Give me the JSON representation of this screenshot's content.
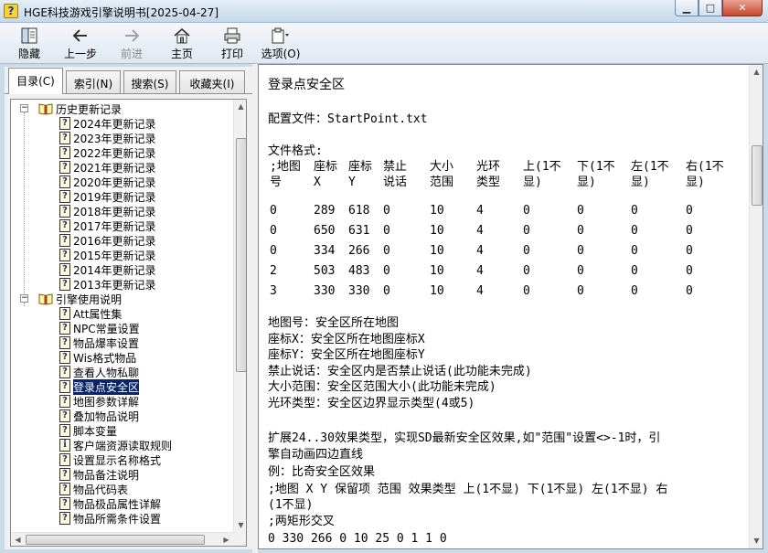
{
  "window": {
    "title": "HGE科技游戏引擎说明书[2025-04-27]",
    "app_icon": "?",
    "controls": {
      "minimize": "▁",
      "maximize": "□",
      "close": "✕"
    }
  },
  "toolbar": {
    "hide": "隐藏",
    "back": "上一步",
    "forward": "前进",
    "home": "主页",
    "print": "打印",
    "options": "选项(O)"
  },
  "tabs": [
    "目录(C)",
    "索引(N)",
    "搜索(S)",
    "收藏夹(I)"
  ],
  "tree": {
    "groups": [
      {
        "label": "历史更新记录",
        "expander": "−",
        "items": [
          {
            "label": "2024年更新记录",
            "icon": "question-doc-icon"
          },
          {
            "label": "2023年更新记录",
            "icon": "question-doc-icon"
          },
          {
            "label": "2022年更新记录",
            "icon": "question-doc-icon"
          },
          {
            "label": "2021年更新记录",
            "icon": "question-doc-icon"
          },
          {
            "label": "2020年更新记录",
            "icon": "question-doc-icon"
          },
          {
            "label": "2019年更新记录",
            "icon": "question-doc-icon"
          },
          {
            "label": "2018年更新记录",
            "icon": "question-doc-icon"
          },
          {
            "label": "2017年更新记录",
            "icon": "question-doc-icon"
          },
          {
            "label": "2016年更新记录",
            "icon": "question-doc-icon"
          },
          {
            "label": "2015年更新记录",
            "icon": "question-doc-icon"
          },
          {
            "label": "2014年更新记录",
            "icon": "question-doc-icon"
          },
          {
            "label": "2013年更新记录",
            "icon": "question-doc-icon"
          }
        ]
      },
      {
        "label": "引擎使用说明",
        "expander": "−",
        "items": [
          {
            "label": "Att属性集",
            "icon": "question-doc-icon"
          },
          {
            "label": "NPC常量设置",
            "icon": "question-doc-icon"
          },
          {
            "label": "物品爆率设置",
            "icon": "question-doc-icon"
          },
          {
            "label": "Wis格式物品",
            "icon": "question-doc-icon"
          },
          {
            "label": "查看人物私聊",
            "icon": "question-doc-icon"
          },
          {
            "label": "登录点安全区",
            "icon": "question-doc-icon",
            "selected": true
          },
          {
            "label": "地图参数详解",
            "icon": "question-doc-icon"
          },
          {
            "label": "叠加物品说明",
            "icon": "question-doc-icon"
          },
          {
            "label": "脚本变量",
            "icon": "question-doc-icon"
          },
          {
            "label": "客户端资源读取规则",
            "icon": "info-doc-icon"
          },
          {
            "label": "设置显示名称格式",
            "icon": "question-doc-icon"
          },
          {
            "label": "物品备注说明",
            "icon": "question-doc-icon"
          },
          {
            "label": "物品代码表",
            "icon": "question-doc-icon"
          },
          {
            "label": "物品极品属性详解",
            "icon": "question-doc-icon"
          },
          {
            "label": "物品所需条件设置",
            "icon": "question-doc-icon"
          }
        ]
      }
    ]
  },
  "content": {
    "heading": "登录点安全区",
    "config_file": "配置文件：StartPoint.txt",
    "format_label": "文件格式:",
    "table_headers": [
      [
        ";地图",
        "号"
      ],
      [
        "座标",
        "X"
      ],
      [
        "座标",
        "Y"
      ],
      [
        "禁止",
        "说话"
      ],
      [
        "大小",
        "范围"
      ],
      [
        "光环",
        "类型"
      ],
      [
        "上(1不",
        "显)"
      ],
      [
        "下(1不",
        "显)"
      ],
      [
        "左(1不",
        "显)"
      ],
      [
        "右(1不",
        "显)"
      ]
    ],
    "table_rows": [
      [
        "0",
        "289",
        "618",
        "0",
        "10",
        "4",
        "0",
        "0",
        "0",
        "0"
      ],
      [
        "0",
        "650",
        "631",
        "0",
        "10",
        "4",
        "0",
        "0",
        "0",
        "0"
      ],
      [
        "0",
        "334",
        "266",
        "0",
        "10",
        "4",
        "0",
        "0",
        "0",
        "0"
      ],
      [
        "2",
        "503",
        "483",
        "0",
        "10",
        "4",
        "0",
        "0",
        "0",
        "0"
      ],
      [
        "3",
        "330",
        "330",
        "0",
        "10",
        "4",
        "0",
        "0",
        "0",
        "0"
      ]
    ],
    "descriptions": [
      "地图号：安全区所在地图",
      "座标X：安全区所在地图座标X",
      "座标Y：安全区所在地图座标Y",
      "禁止说话：安全区内是否禁止说话(此功能未完成)",
      "大小范围：安全区范围大小(此功能未完成)",
      "光环类型：安全区边界显示类型(4或5)"
    ],
    "extension_line1": "扩展24..30效果类型，实现SD最新安全区效果,如\"范围\"设置<>-1时，引",
    "extension_line2": "擎自动画四边直线",
    "example_label": "例：比奇安全区效果",
    "example_format_1": ";地图 X Y 保留项 范围 效果类型 上(1不显) 下(1不显) 左(1不显) 右",
    "example_format_2": "(1不显)",
    "example_comment": ";两矩形交叉",
    "example_data": "0 330 266 0 10 25 0 1 1 0"
  }
}
